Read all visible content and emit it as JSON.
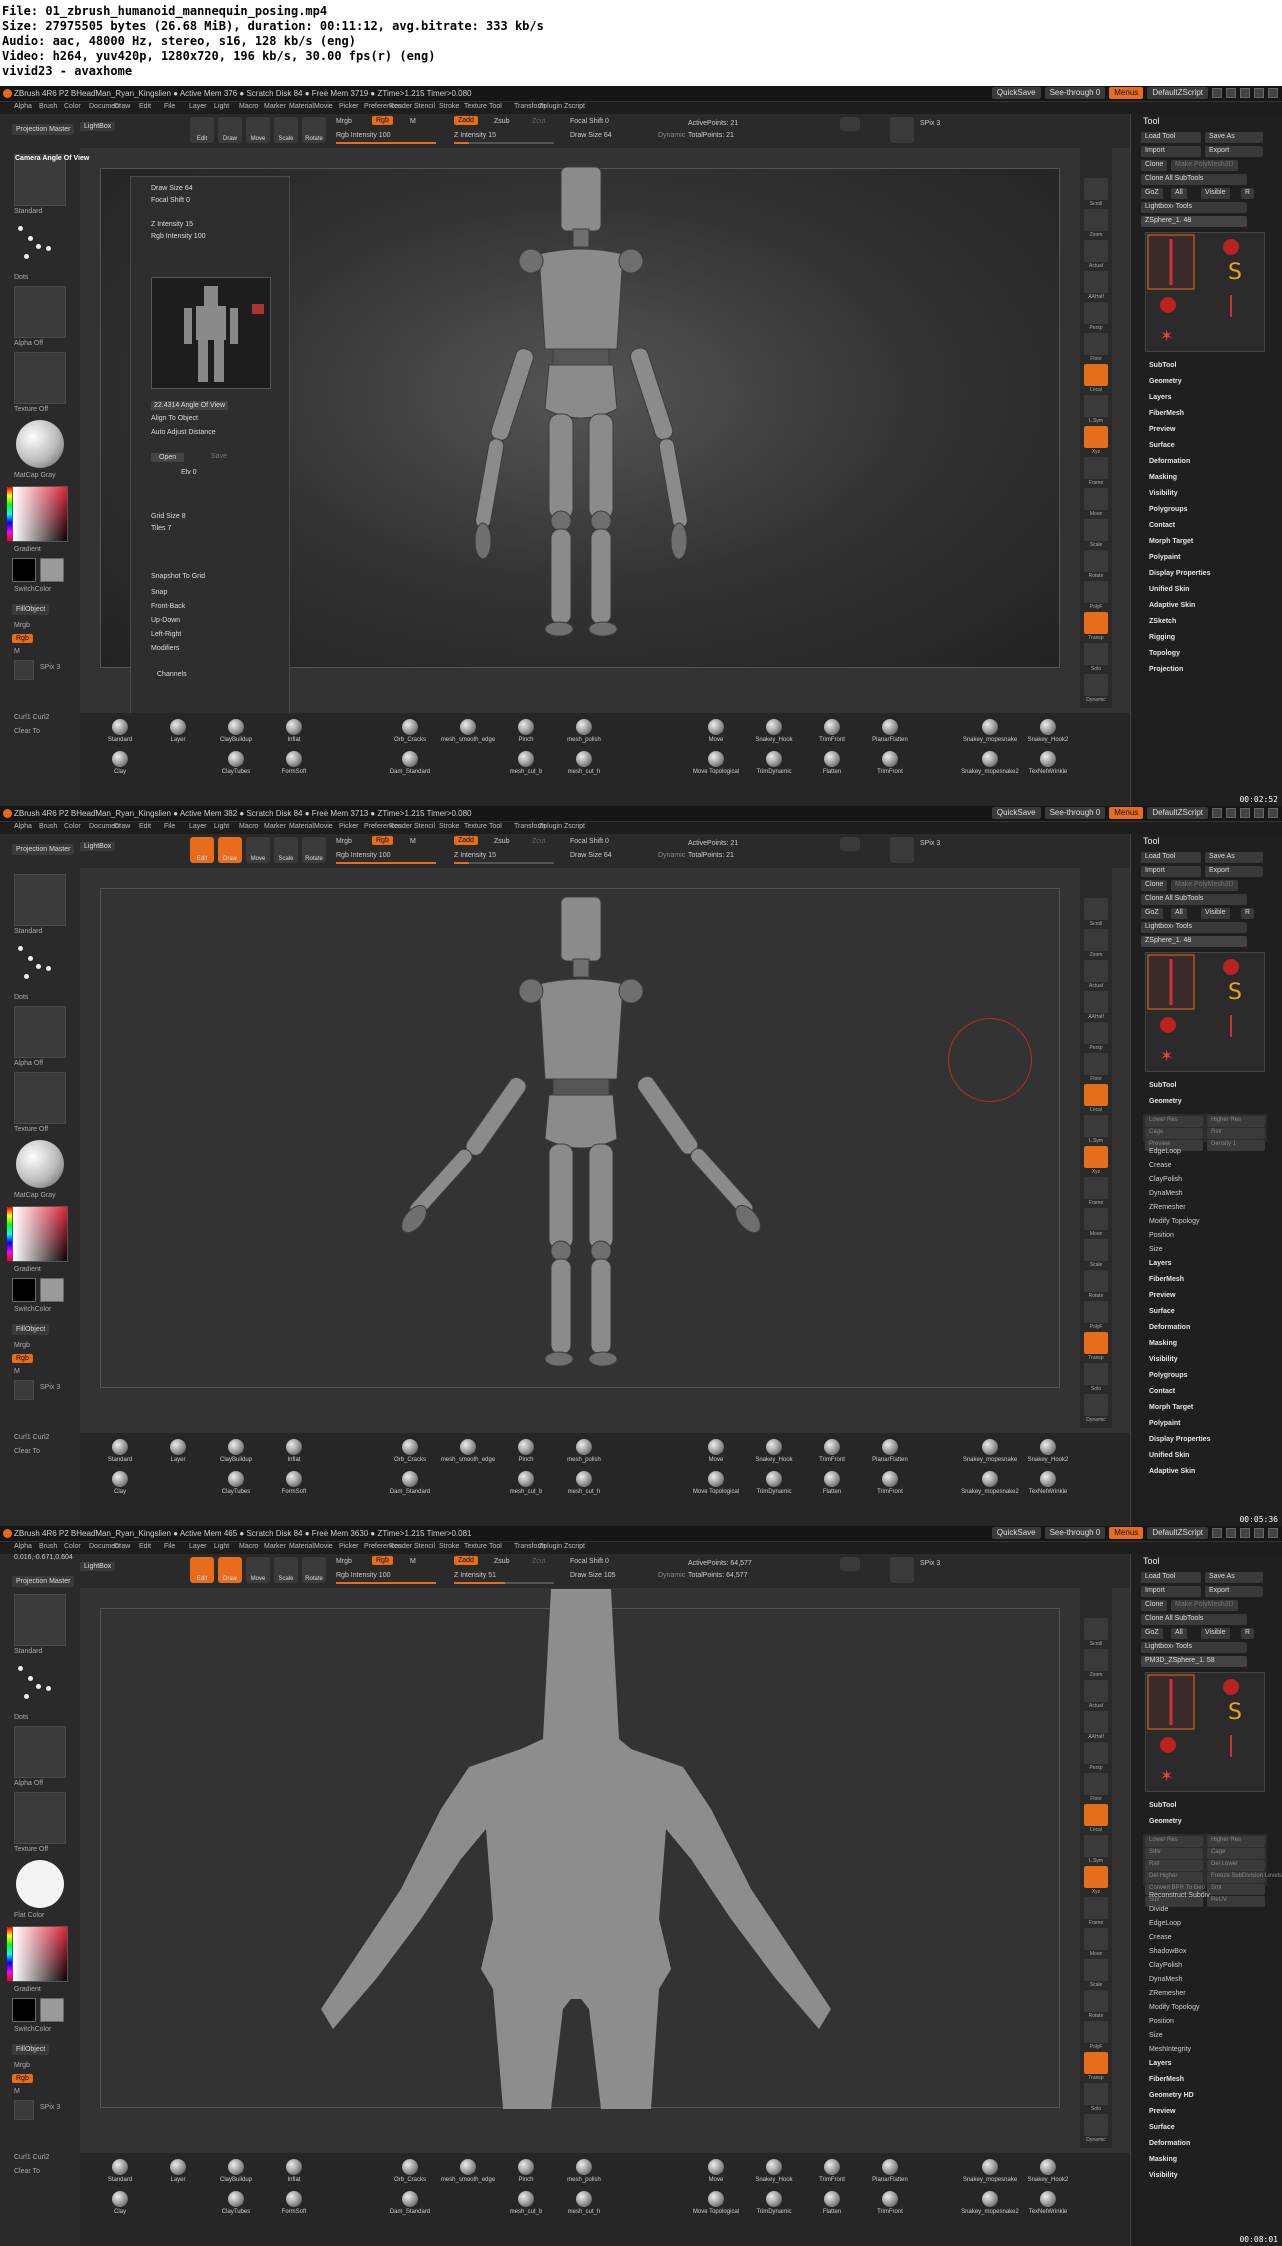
{
  "header": {
    "file": "File: 01_zbrush_humanoid_mannequin_posing.mp4",
    "size": "Size: 27975505 bytes (26.68 MiB), duration: 00:11:12, avg.bitrate: 333 kb/s",
    "audio": "Audio: aac, 48000 Hz, stereo, s16, 128 kb/s (eng)",
    "video": "Video: h264, yuv420p, 1280x720, 196 kb/s, 30.00 fps(r) (eng)",
    "credit": "vivid23 - avaxhome"
  },
  "colors": {
    "accent": "#e86d1b",
    "background": "#262626",
    "panel": "#1f1f1f",
    "canvas": "#333333",
    "model": "#8a8a8a"
  },
  "frames": [
    {
      "title": "ZBrush 4R6 P2   BHeadMan_Ryan_Kingslien   ● Active Mem 376 ● Scratch Disk 84 ● Free Mem 3719 ● ZTime>1.215 Timer>0.080",
      "timecode": "00:02:52",
      "quicksave": "QuickSave",
      "seethrough": "See-through  0",
      "menus": "Menus",
      "script": "DefaultZScript",
      "menu": [
        "Alpha",
        "Brush",
        "Color",
        "Document",
        "Draw",
        "Edit",
        "File",
        "Layer",
        "Light",
        "Macro",
        "Marker",
        "Material",
        "Movie",
        "Picker",
        "Preferences",
        "Render",
        "Stencil",
        "Stroke",
        "Texture",
        "Tool",
        "Transform",
        "Zplugin",
        "Zscript"
      ],
      "left": {
        "projection": "Projection Master",
        "lightbox": "LightBox",
        "brush_label": "Standard",
        "stroke_label": "Dots",
        "alpha_label": "Alpha Off",
        "texture_label": "Texture Off",
        "material_label": "MatCap Gray",
        "gradient": "Gradient",
        "switchcolor": "SwitchColor",
        "fillobject": "FillObject",
        "mrgb": "Mrgb",
        "rgb": "Rgb",
        "m": "M",
        "spix": "SPix 3",
        "curl": "Curl1  Curl2",
        "clear": "Clear To"
      },
      "top": {
        "draw": "Draw",
        "edit": "Edit",
        "move": "Move",
        "scale": "Scale",
        "rotate": "Rotate",
        "mrgb": "Mrgb",
        "rgb": "Rgb",
        "m": "M",
        "rgb_intensity": "Rgb Intensity 100",
        "zadd": "Zadd",
        "zsub": "Zsub",
        "zcut": "Zcut",
        "z_intensity": "Z Intensity 15",
        "focal_shift": "Focal Shift 0",
        "draw_size": "Draw Size 64",
        "dynamic": "Dynamic",
        "active_points": "ActivePoints: 21",
        "total_points": "TotalPoints: 21",
        "spix": "SPix 3"
      },
      "drawpalette": {
        "camera": "Camera Angle Of View",
        "draw_size": "Draw Size 64",
        "focal_shift": "Focal Shift 0",
        "z_intensity": "Z Intensity 15",
        "rgb_intensity": "Rgb Intensity 100",
        "angle": "22.4314 Angle Of View",
        "align": "Align To Object",
        "auto_adjust": "Auto Adjust Distance",
        "open": "Open",
        "save": "Save",
        "elv": "Elv 0",
        "grid_size": "Grid Size 8",
        "tiles": "Tiles 7",
        "snapshot": "Snapshot To Grid",
        "snap": "Snap",
        "front_back": "Front-Back",
        "up_down": "Up-Down",
        "left_right": "Left-Right",
        "modifiers": "Modifiers",
        "channels": "Channels"
      },
      "tool": {
        "title": "Tool",
        "load": "Load Tool",
        "saveas": "Save As",
        "import": "Import",
        "export": "Export",
        "clone": "Clone",
        "make_poly": "Make PolyMesh3D",
        "clone_all": "Clone All SubTools",
        "goz": "GoZ",
        "all": "All",
        "visible": "Visible",
        "r": "R",
        "lightbox_tools": "Lightbox› Tools",
        "current": "ZSphere_1. 48",
        "thumbs": [
          "ZSphere_1",
          "ZSphere3D",
          "SimpleBrush",
          "ZSphere",
          "ZSphere_1",
          "PolyMesh3D"
        ],
        "sections": [
          "SubTool",
          "Geometry",
          "Layers",
          "FiberMesh",
          "Preview",
          "Surface",
          "Deformation",
          "Masking",
          "Visibility",
          "Polygroups",
          "Contact",
          "Morph Target",
          "Polypaint",
          "Display Properties",
          "Unified Skin",
          "Adaptive Skin",
          "ZSketch",
          "Rigging",
          "Topology",
          "Projection"
        ]
      },
      "nav": [
        "Scroll",
        "Zoom",
        "Actual",
        "AAHalf",
        "Persp",
        "Floor",
        "Local",
        "L.Sym",
        "Xyz",
        "Frame",
        "Move",
        "Scale",
        "Rotate",
        "PolyF",
        "Transp",
        "Solo",
        "Dynamic"
      ],
      "brushes_row1": [
        "Standard",
        "Layer",
        "ClayBuildup",
        "Inflat",
        "Orb_Cracks",
        "mesh_smooth_edge",
        "Pinch",
        "mesh_polish",
        "Move",
        "Snakey_Hook",
        "TrimFront",
        "PlanarFlatten",
        "Snakey_mopesnake",
        "Snakey_Hook2"
      ],
      "brushes_row2": [
        "Clay",
        "ClayTubes",
        "FormSoft",
        "Dam_Standard",
        "mesh_cut_b",
        "mesh_cut_h",
        "Move Topological",
        "TrimDynamic",
        "Flatten",
        "TrimFront",
        "Snakey_mopesnake2",
        "TexNetWrinkle"
      ]
    },
    {
      "title": "ZBrush 4R6 P2   BHeadMan_Ryan_Kingslien   ● Active Mem 382 ● Scratch Disk 84 ● Free Mem 3713 ● ZTime>1.215 Timer>0.080",
      "timecode": "00:05:36",
      "tool_sections": [
        "SubTool",
        "Geometry",
        "EdgeLoop",
        "Crease",
        "ClayPolish",
        "DynaMesh",
        "ZRemesher",
        "Modify Topology",
        "Position",
        "Size",
        "Layers",
        "FiberMesh",
        "Preview",
        "Surface",
        "Deformation",
        "Masking",
        "Visibility",
        "Polygroups",
        "Contact",
        "Morph Target",
        "Polypaint",
        "Display Properties",
        "Unified Skin",
        "Adaptive Skin"
      ],
      "geometry_controls": [
        "Lower Res",
        "Higher Res",
        "Cage",
        "Rstr",
        "Preview",
        "Density 1"
      ],
      "active_points": "ActivePoints: 21",
      "total_points": "TotalPoints: 21"
    },
    {
      "title": "ZBrush 4R6 P2   BHeadMan_Ryan_Kingslien   ● Active Mem 465 ● Scratch Disk 84 ● Free Mem 3630 ● ZTime>1.215 Timer>0.081",
      "timecode": "00:08:01",
      "coords": "0.016,-0.671,0.604",
      "z_intensity": "Z Intensity 51",
      "focal_shift": "Focal Shift 0",
      "draw_size": "Draw Size 105",
      "active_points": "ActivePoints: 64,577",
      "total_points": "TotalPoints: 64,577",
      "current_tool": "PM3D_ZSphere_1. 58",
      "material_label": "Flat Color",
      "tool_sections": [
        "SubTool",
        "Geometry",
        "Reconstruct Subdiv",
        "Divide",
        "EdgeLoop",
        "Crease",
        "ShadowBox",
        "ClayPolish",
        "DynaMesh",
        "ZRemesher",
        "Modify Topology",
        "Position",
        "Size",
        "MeshIntegrity",
        "Layers",
        "FiberMesh",
        "Geometry HD",
        "Preview",
        "Surface",
        "Deformation",
        "Masking",
        "Visibility"
      ],
      "geometry_controls": [
        "Lower Res",
        "Higher Res",
        "Sdiv",
        "Cage",
        "Rstr",
        "Del Lower",
        "Del Higher",
        "Freeze SubDivision Levels",
        "Convert BPR To Geo",
        "Smt",
        "Suv",
        "ReUV"
      ]
    }
  ]
}
